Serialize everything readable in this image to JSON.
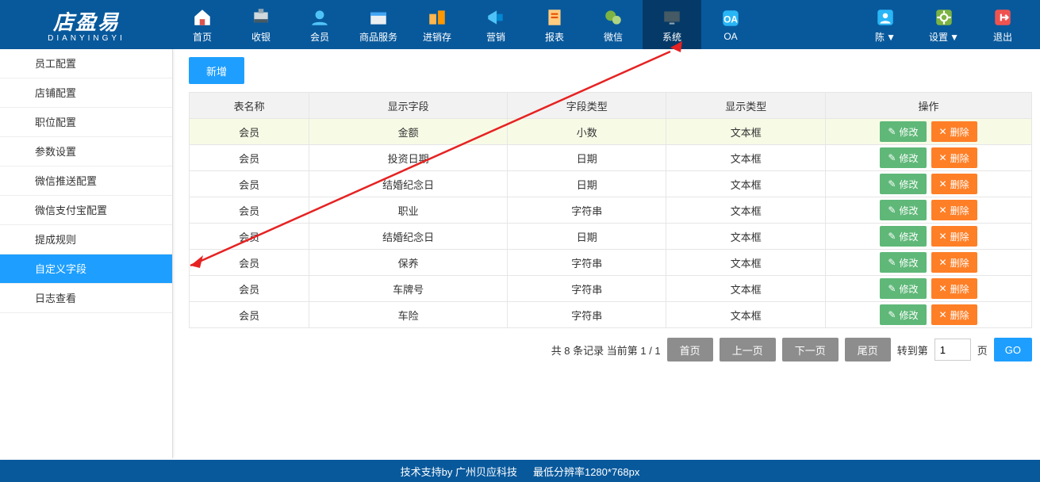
{
  "logo": {
    "cn": "店盈易",
    "en": "DIANYINGYI"
  },
  "nav": [
    {
      "key": "home",
      "label": "首页"
    },
    {
      "key": "cashier",
      "label": "收银"
    },
    {
      "key": "member",
      "label": "会员"
    },
    {
      "key": "goods",
      "label": "商品服务"
    },
    {
      "key": "stock",
      "label": "进销存"
    },
    {
      "key": "marketing",
      "label": "营销"
    },
    {
      "key": "report",
      "label": "报表"
    },
    {
      "key": "wechat",
      "label": "微信"
    },
    {
      "key": "system",
      "label": "系统",
      "active": true
    },
    {
      "key": "oa",
      "label": "OA"
    }
  ],
  "navRight": [
    {
      "key": "user",
      "label": "陈"
    },
    {
      "key": "settings",
      "label": "设置"
    },
    {
      "key": "logout",
      "label": "退出"
    }
  ],
  "sidebar": [
    "员工配置",
    "店铺配置",
    "职位配置",
    "参数设置",
    "微信推送配置",
    "微信支付宝配置",
    "提成规则",
    "自定义字段",
    "日志查看"
  ],
  "sidebarActiveIndex": 7,
  "actions": {
    "add": "新增",
    "edit": "修改",
    "delete": "删除"
  },
  "table": {
    "headers": [
      "表名称",
      "显示字段",
      "字段类型",
      "显示类型",
      "操作"
    ],
    "rows": [
      [
        "会员",
        "金额",
        "小数",
        "文本框"
      ],
      [
        "会员",
        "投资日期",
        "日期",
        "文本框"
      ],
      [
        "会员",
        "结婚纪念日",
        "日期",
        "文本框"
      ],
      [
        "会员",
        "职业",
        "字符串",
        "文本框"
      ],
      [
        "会员",
        "结婚纪念日",
        "日期",
        "文本框"
      ],
      [
        "会员",
        "保养",
        "字符串",
        "文本框"
      ],
      [
        "会员",
        "车牌号",
        "字符串",
        "文本框"
      ],
      [
        "会员",
        "车险",
        "字符串",
        "文本框"
      ]
    ]
  },
  "pager": {
    "summary": "共 8 条记录 当前第 1 / 1",
    "first": "首页",
    "prev": "上一页",
    "next": "下一页",
    "last": "尾页",
    "gotoLabel": "转到第",
    "pageSuffix": "页",
    "go": "GO",
    "pageInput": "1"
  },
  "footer": {
    "support": "技术支持by 广州贝应科技",
    "res": "最低分辨率1280*768px"
  }
}
